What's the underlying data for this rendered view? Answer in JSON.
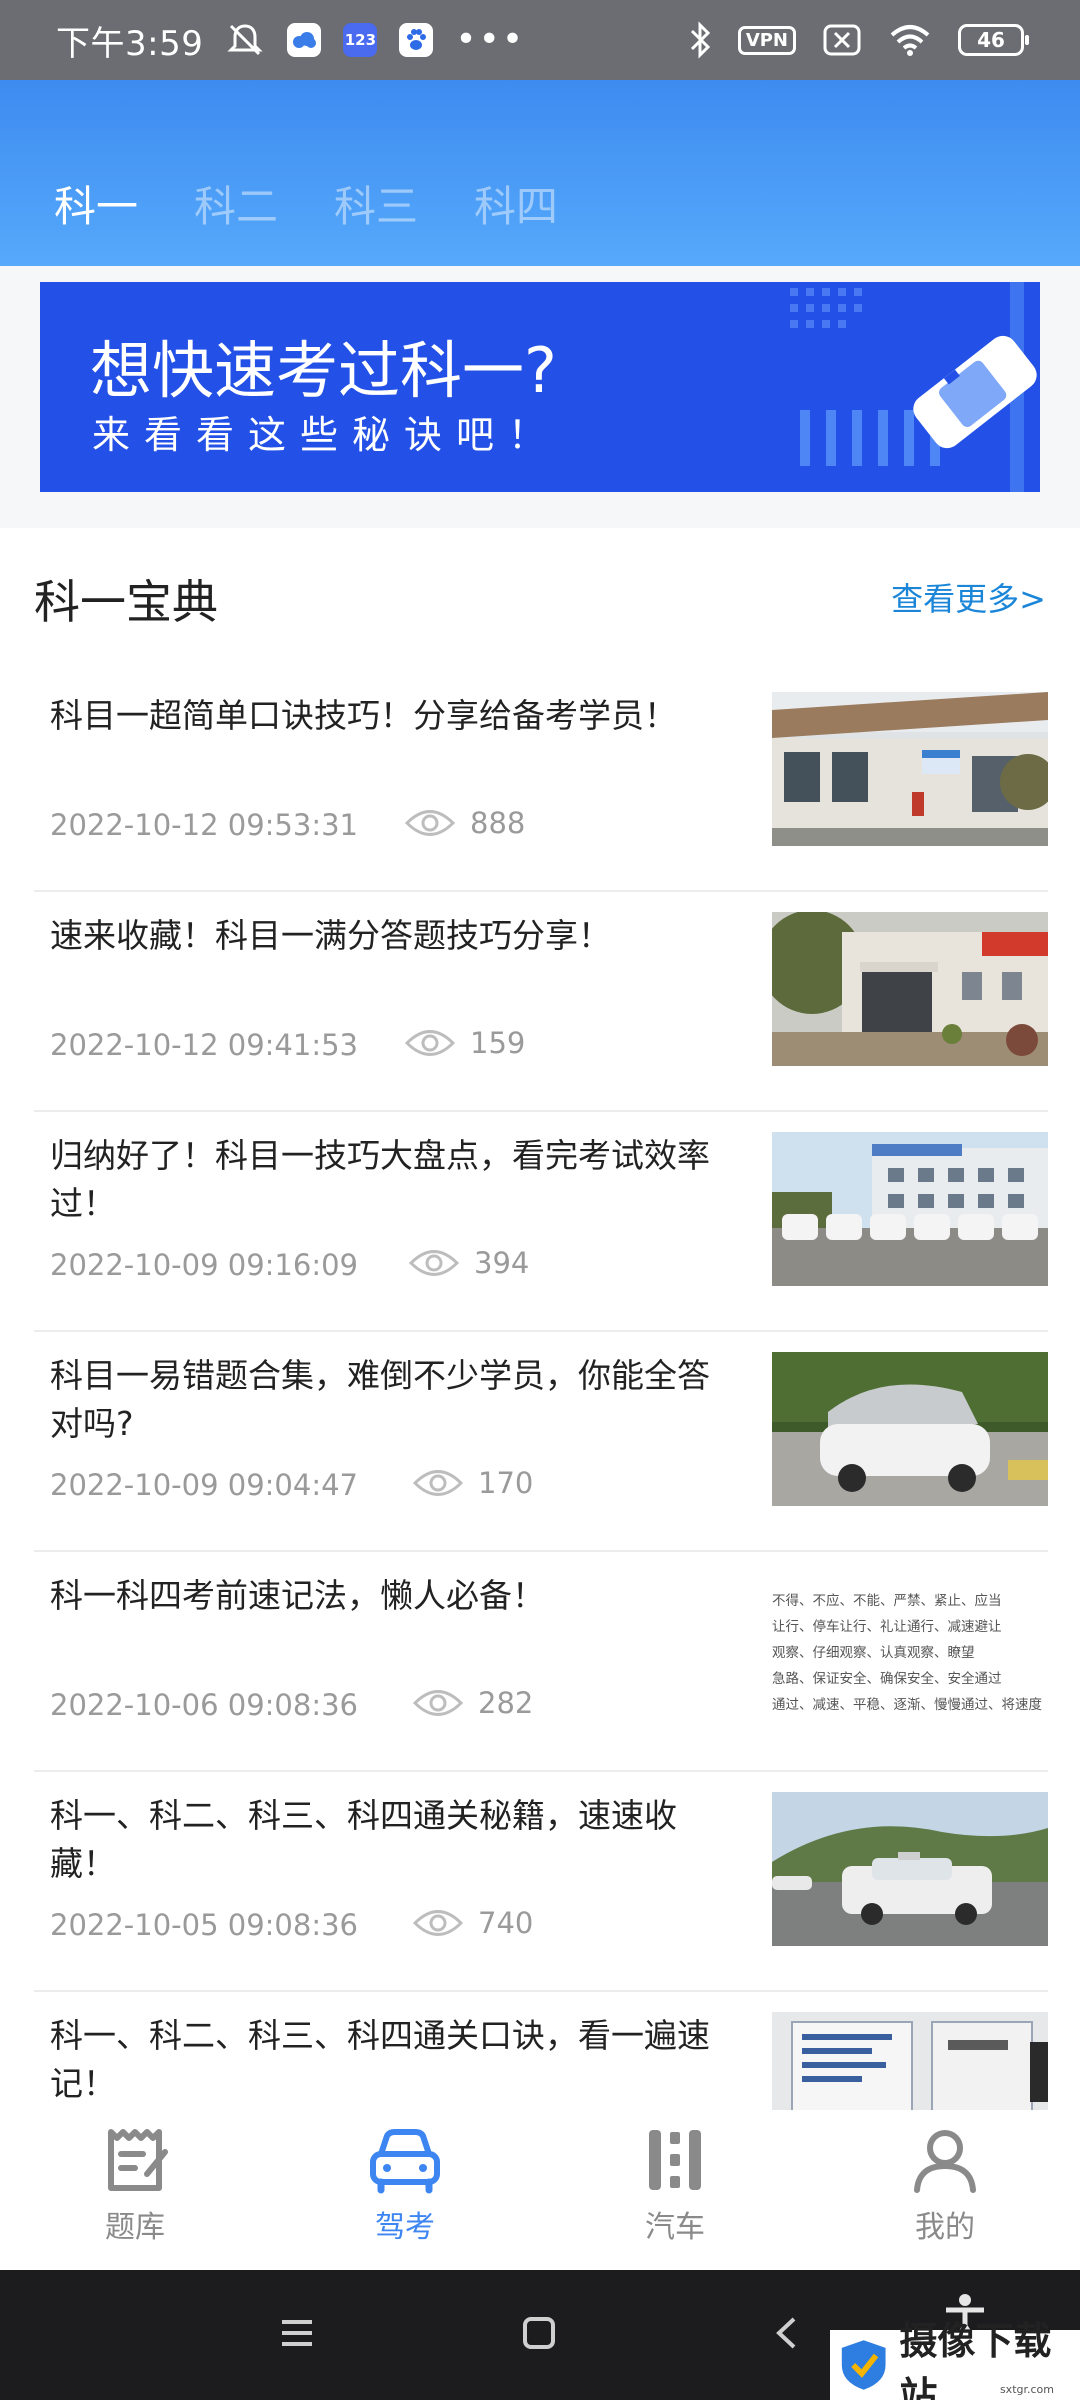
{
  "status_bar": {
    "time": "下午3:59",
    "app_badge": "123",
    "dots": "•••",
    "vpn": "VPN",
    "battery": "46"
  },
  "tabs": [
    "科一",
    "科二",
    "科三",
    "科四"
  ],
  "active_tab": 0,
  "banner": {
    "title": "想快速考过科一?",
    "subtitle": "来看看这些秘诀吧！"
  },
  "section": {
    "title": "科一宝典",
    "more": "查看更多>"
  },
  "articles": [
    {
      "title": "科目一超简单口诀技巧！分享给备考学员！",
      "date": "2022-10-12 09:53:31",
      "views": "888",
      "thumb": "building"
    },
    {
      "title": "速来收藏！科目一满分答题技巧分享！",
      "date": "2022-10-12 09:41:53",
      "views": "159",
      "thumb": "entrance"
    },
    {
      "title": "归纳好了！科目一技巧大盘点，看完考试效率过！",
      "date": "2022-10-09 09:16:09",
      "views": "394",
      "thumb": "cars-row"
    },
    {
      "title": "科目一易错题合集，难倒不少学员，你能全答对吗?",
      "date": "2022-10-09 09:04:47",
      "views": "170",
      "thumb": "covered-car"
    },
    {
      "title": "科一科四考前速记法，懒人必备！",
      "date": "2022-10-06 09:08:36",
      "views": "282",
      "thumb": "text",
      "thumb_text": [
        "不得、不应、不能、严禁、紧止、应当",
        "让行、停车让行、礼让通行、减速避让",
        "观察、仔细观察、认真观察、瞭望",
        "急路、保证安全、确保安全、安全通过",
        "通过、减速、平稳、逐渐、慢慢通过、将速度"
      ]
    },
    {
      "title": "科一、科二、科三、科四通关秘籍，速速收藏！",
      "date": "2022-10-05 09:08:36",
      "views": "740",
      "thumb": "training-car"
    },
    {
      "title": "科一、科二、科三、科四通关口诀，看一遍速记！",
      "date": "",
      "views": "",
      "thumb": "sign-board"
    }
  ],
  "bottom_nav": [
    {
      "label": "题库",
      "icon": "question-bank-icon"
    },
    {
      "label": "驾考",
      "icon": "car-icon"
    },
    {
      "label": "汽车",
      "icon": "automobile-icon"
    },
    {
      "label": "我的",
      "icon": "profile-icon"
    }
  ],
  "active_nav": 1,
  "watermark": {
    "text": "摄像下载站",
    "url": "sxtgr.com"
  },
  "colors": {
    "header": "#4a9bf7",
    "banner": "#2350e6",
    "accent": "#3d86f2",
    "link": "#1b86d8"
  }
}
